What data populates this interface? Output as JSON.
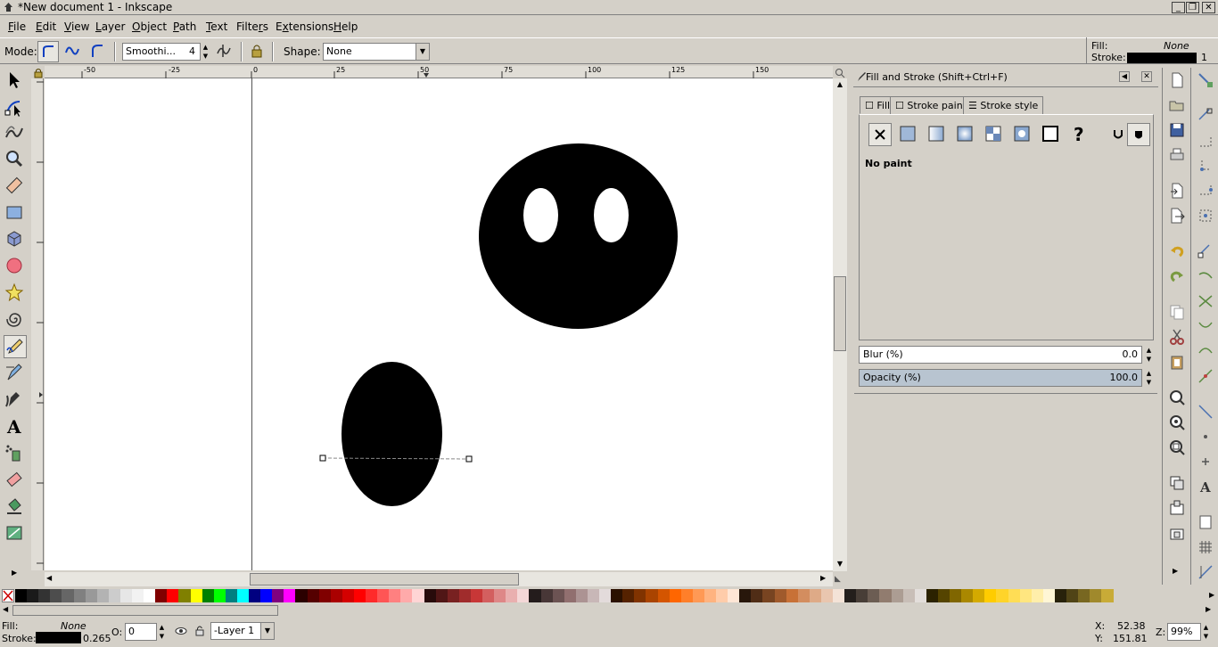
{
  "window": {
    "title": "*New document 1 - Inkscape"
  },
  "menu": [
    "File",
    "Edit",
    "View",
    "Layer",
    "Object",
    "Path",
    "Text",
    "Filters",
    "Extensions",
    "Help"
  ],
  "menu_underline": [
    "F",
    "E",
    "V",
    "L",
    "O",
    "P",
    "T",
    "r",
    "x",
    "H"
  ],
  "toolctrl": {
    "mode_label": "Mode:",
    "smoothing_value": "Smoothi...",
    "smoothing_num": "4",
    "shape_label": "Shape:",
    "shape_value": "None"
  },
  "indicator": {
    "fill_label": "Fill:",
    "fill_value": "None",
    "stroke_label": "Stroke:",
    "stroke_width": "1"
  },
  "ruler_top": {
    "labels": [
      "-50",
      "-25",
      "0",
      "25",
      "50",
      "75",
      "100",
      "125",
      "150"
    ]
  },
  "ruler_left": {
    "labels": [
      "0",
      "25",
      "50",
      "75",
      "100",
      "125",
      "150",
      "175"
    ]
  },
  "dialog": {
    "title": "Fill and Stroke (Shift+Ctrl+F)",
    "tabs": [
      "Fill",
      "Stroke paint",
      "Stroke style"
    ],
    "paint_status": "No paint",
    "blur_label": "Blur (%)",
    "blur_value": "0.0",
    "opacity_label": "Opacity (%)",
    "opacity_value": "100.0",
    "opacity_fraction": 1.0
  },
  "status": {
    "fill_label": "Fill:",
    "fill_value": "None",
    "stroke_label": "Stroke:",
    "stroke_width": "0.265",
    "opacity_label": "O:",
    "opacity_value": "0",
    "layer_value": "-Layer 1",
    "x_label": "X:",
    "x_value": "52.38",
    "y_label": "Y:",
    "y_value": "151.81",
    "zoom_label": "Z:",
    "zoom_value": "99%"
  },
  "colors": {
    "accent": "#0000ff",
    "palette": [
      "#000000",
      "#1a1a1a",
      "#333333",
      "#4d4d4d",
      "#666666",
      "#808080",
      "#999999",
      "#b3b3b3",
      "#cccccc",
      "#e6e6e6",
      "#f2f2f2",
      "#ffffff",
      "#800000",
      "#ff0000",
      "#808000",
      "#ffff00",
      "#008000",
      "#00ff00",
      "#008080",
      "#00ffff",
      "#000080",
      "#0000ff",
      "#800080",
      "#ff00ff",
      "#2b0000",
      "#550000",
      "#800000",
      "#aa0000",
      "#d40000",
      "#ff0000",
      "#ff2a2a",
      "#ff5555",
      "#ff8080",
      "#ffaaaa",
      "#ffd5d5",
      "#280b0b",
      "#501616",
      "#782121",
      "#a02c2c",
      "#c83737",
      "#d35f5f",
      "#de8787",
      "#e9afaf",
      "#f4d7d7",
      "#241c1c",
      "#483737",
      "#6c5353",
      "#916f6f",
      "#ac9393",
      "#c8b7b7",
      "#e3dbdb",
      "#2b1100",
      "#552200",
      "#803300",
      "#aa4400",
      "#d45500",
      "#ff6600",
      "#ff7f2a",
      "#ff9955",
      "#ffb380",
      "#ffccaa",
      "#ffe6d5",
      "#28170b",
      "#502d16",
      "#784421",
      "#a05a2c",
      "#c87137",
      "#d38d5f",
      "#deaa87",
      "#e9c6af",
      "#f4e3d7",
      "#241f1c",
      "#483e37",
      "#6c5d53",
      "#917c6f",
      "#ac9d93",
      "#c8beb7",
      "#e3dedb",
      "#2b2200",
      "#554400",
      "#806600",
      "#aa8800",
      "#d4aa00",
      "#ffcc00",
      "#ffd42a",
      "#ffdd55",
      "#ffe680",
      "#ffeeaa",
      "#fff6d5",
      "#28220b",
      "#504416",
      "#786721",
      "#a0892c",
      "#c8ab37"
    ]
  }
}
